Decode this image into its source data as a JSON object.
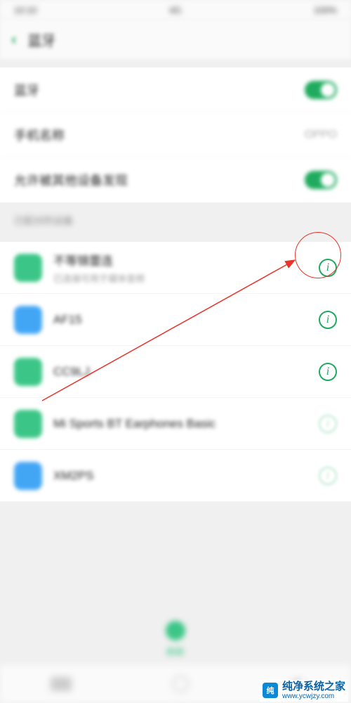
{
  "status_bar": {
    "left": "10:10",
    "center": "4G",
    "right": "100%"
  },
  "header": {
    "back_glyph": "‹",
    "title": "蓝牙"
  },
  "settings": {
    "bluetooth_label": "蓝牙",
    "device_name_label": "手机名称",
    "device_name_value": "OPPO",
    "allow_discovery_label": "允许被其他设备发现"
  },
  "paired_section": {
    "header": "已配对的设备",
    "devices": [
      {
        "name": "不等锦蕾连",
        "sub": "已连接可用于媒体音频",
        "icon_color": "green",
        "info_style": "highlight"
      },
      {
        "name": "AF15",
        "sub": "",
        "icon_color": "blue",
        "info_style": "normal"
      },
      {
        "name": "CC9LJ",
        "sub": "",
        "icon_color": "green",
        "info_style": "normal"
      },
      {
        "name": "Mi Sports BT Earphones Basic",
        "sub": "",
        "icon_color": "green",
        "info_style": "faded"
      },
      {
        "name": "XM2PS",
        "sub": "",
        "icon_color": "blue",
        "info_style": "faded"
      }
    ]
  },
  "bottom_action": {
    "label": "刷新"
  },
  "watermark": {
    "logo_text": "纯",
    "main": "纯净系统之家",
    "sub": "www.ycwjzy.com"
  },
  "annotation": {
    "target_index": 0
  }
}
